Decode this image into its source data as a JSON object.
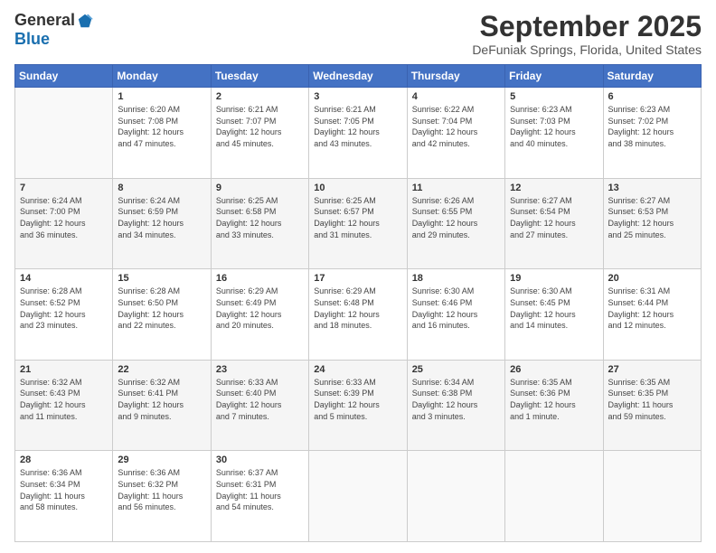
{
  "logo": {
    "general": "General",
    "blue": "Blue"
  },
  "title": "September 2025",
  "location": "DeFuniak Springs, Florida, United States",
  "weekdays": [
    "Sunday",
    "Monday",
    "Tuesday",
    "Wednesday",
    "Thursday",
    "Friday",
    "Saturday"
  ],
  "weeks": [
    [
      {
        "day": "",
        "info": ""
      },
      {
        "day": "1",
        "info": "Sunrise: 6:20 AM\nSunset: 7:08 PM\nDaylight: 12 hours\nand 47 minutes."
      },
      {
        "day": "2",
        "info": "Sunrise: 6:21 AM\nSunset: 7:07 PM\nDaylight: 12 hours\nand 45 minutes."
      },
      {
        "day": "3",
        "info": "Sunrise: 6:21 AM\nSunset: 7:05 PM\nDaylight: 12 hours\nand 43 minutes."
      },
      {
        "day": "4",
        "info": "Sunrise: 6:22 AM\nSunset: 7:04 PM\nDaylight: 12 hours\nand 42 minutes."
      },
      {
        "day": "5",
        "info": "Sunrise: 6:23 AM\nSunset: 7:03 PM\nDaylight: 12 hours\nand 40 minutes."
      },
      {
        "day": "6",
        "info": "Sunrise: 6:23 AM\nSunset: 7:02 PM\nDaylight: 12 hours\nand 38 minutes."
      }
    ],
    [
      {
        "day": "7",
        "info": "Sunrise: 6:24 AM\nSunset: 7:00 PM\nDaylight: 12 hours\nand 36 minutes."
      },
      {
        "day": "8",
        "info": "Sunrise: 6:24 AM\nSunset: 6:59 PM\nDaylight: 12 hours\nand 34 minutes."
      },
      {
        "day": "9",
        "info": "Sunrise: 6:25 AM\nSunset: 6:58 PM\nDaylight: 12 hours\nand 33 minutes."
      },
      {
        "day": "10",
        "info": "Sunrise: 6:25 AM\nSunset: 6:57 PM\nDaylight: 12 hours\nand 31 minutes."
      },
      {
        "day": "11",
        "info": "Sunrise: 6:26 AM\nSunset: 6:55 PM\nDaylight: 12 hours\nand 29 minutes."
      },
      {
        "day": "12",
        "info": "Sunrise: 6:27 AM\nSunset: 6:54 PM\nDaylight: 12 hours\nand 27 minutes."
      },
      {
        "day": "13",
        "info": "Sunrise: 6:27 AM\nSunset: 6:53 PM\nDaylight: 12 hours\nand 25 minutes."
      }
    ],
    [
      {
        "day": "14",
        "info": "Sunrise: 6:28 AM\nSunset: 6:52 PM\nDaylight: 12 hours\nand 23 minutes."
      },
      {
        "day": "15",
        "info": "Sunrise: 6:28 AM\nSunset: 6:50 PM\nDaylight: 12 hours\nand 22 minutes."
      },
      {
        "day": "16",
        "info": "Sunrise: 6:29 AM\nSunset: 6:49 PM\nDaylight: 12 hours\nand 20 minutes."
      },
      {
        "day": "17",
        "info": "Sunrise: 6:29 AM\nSunset: 6:48 PM\nDaylight: 12 hours\nand 18 minutes."
      },
      {
        "day": "18",
        "info": "Sunrise: 6:30 AM\nSunset: 6:46 PM\nDaylight: 12 hours\nand 16 minutes."
      },
      {
        "day": "19",
        "info": "Sunrise: 6:30 AM\nSunset: 6:45 PM\nDaylight: 12 hours\nand 14 minutes."
      },
      {
        "day": "20",
        "info": "Sunrise: 6:31 AM\nSunset: 6:44 PM\nDaylight: 12 hours\nand 12 minutes."
      }
    ],
    [
      {
        "day": "21",
        "info": "Sunrise: 6:32 AM\nSunset: 6:43 PM\nDaylight: 12 hours\nand 11 minutes."
      },
      {
        "day": "22",
        "info": "Sunrise: 6:32 AM\nSunset: 6:41 PM\nDaylight: 12 hours\nand 9 minutes."
      },
      {
        "day": "23",
        "info": "Sunrise: 6:33 AM\nSunset: 6:40 PM\nDaylight: 12 hours\nand 7 minutes."
      },
      {
        "day": "24",
        "info": "Sunrise: 6:33 AM\nSunset: 6:39 PM\nDaylight: 12 hours\nand 5 minutes."
      },
      {
        "day": "25",
        "info": "Sunrise: 6:34 AM\nSunset: 6:38 PM\nDaylight: 12 hours\nand 3 minutes."
      },
      {
        "day": "26",
        "info": "Sunrise: 6:35 AM\nSunset: 6:36 PM\nDaylight: 12 hours\nand 1 minute."
      },
      {
        "day": "27",
        "info": "Sunrise: 6:35 AM\nSunset: 6:35 PM\nDaylight: 11 hours\nand 59 minutes."
      }
    ],
    [
      {
        "day": "28",
        "info": "Sunrise: 6:36 AM\nSunset: 6:34 PM\nDaylight: 11 hours\nand 58 minutes."
      },
      {
        "day": "29",
        "info": "Sunrise: 6:36 AM\nSunset: 6:32 PM\nDaylight: 11 hours\nand 56 minutes."
      },
      {
        "day": "30",
        "info": "Sunrise: 6:37 AM\nSunset: 6:31 PM\nDaylight: 11 hours\nand 54 minutes."
      },
      {
        "day": "",
        "info": ""
      },
      {
        "day": "",
        "info": ""
      },
      {
        "day": "",
        "info": ""
      },
      {
        "day": "",
        "info": ""
      }
    ]
  ]
}
